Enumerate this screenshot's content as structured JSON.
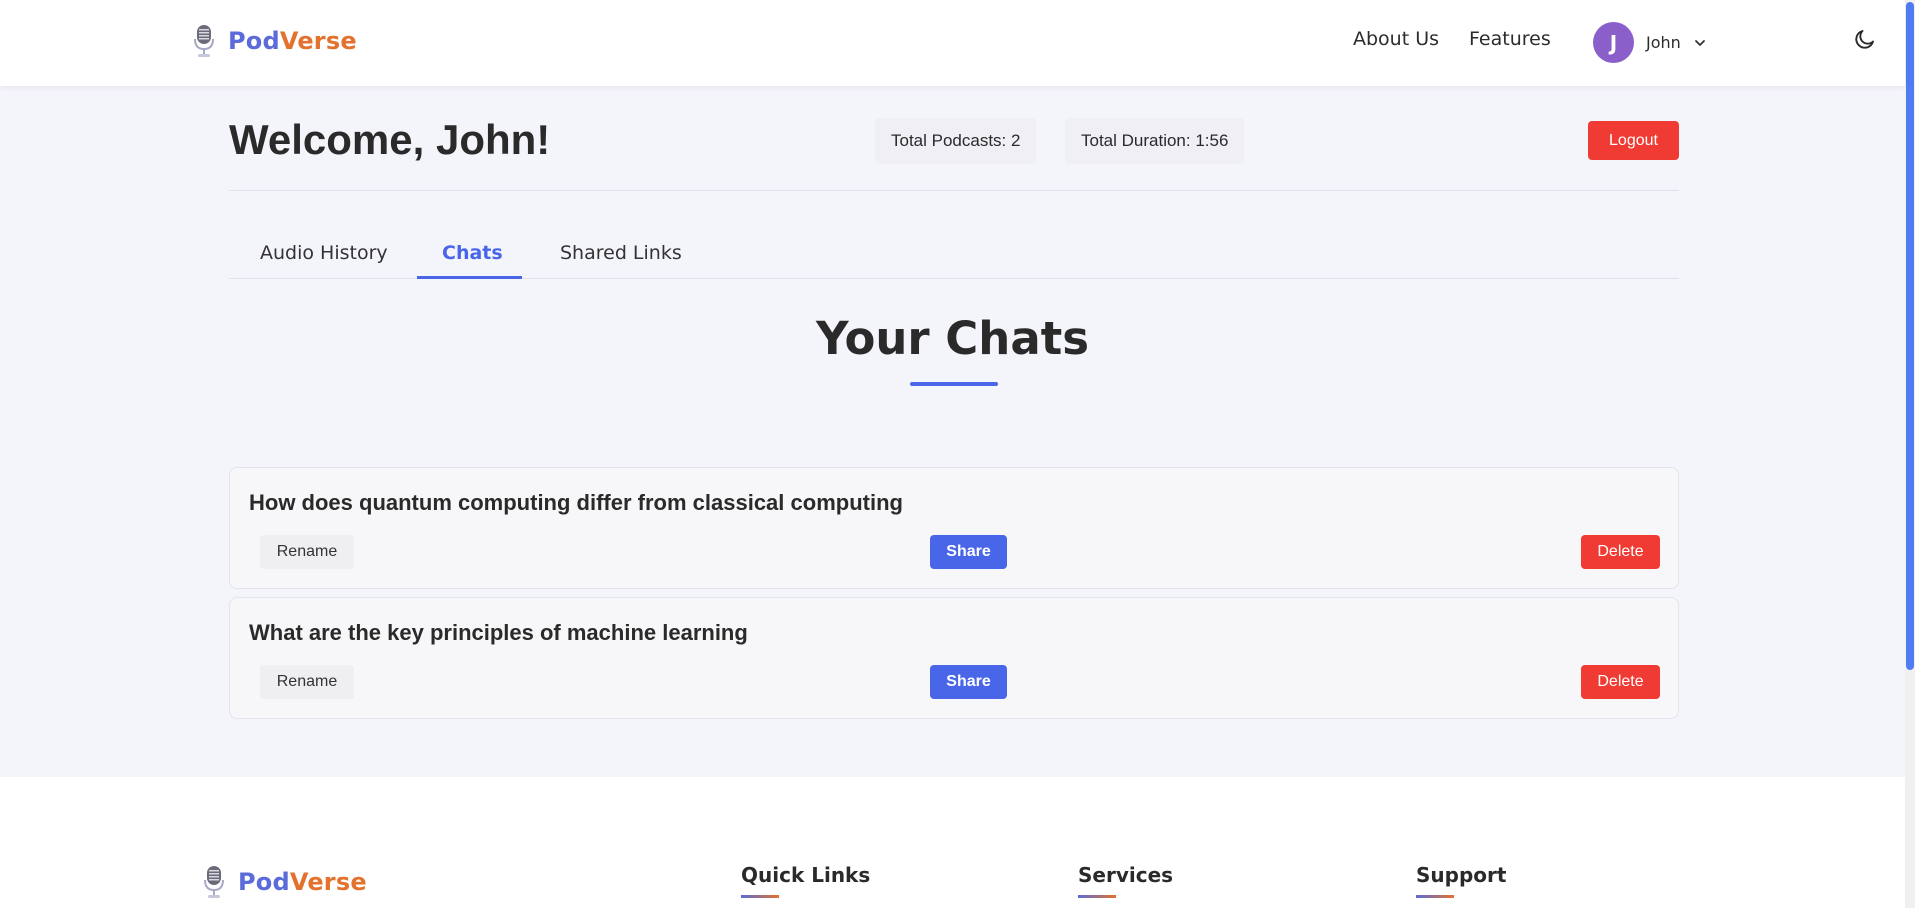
{
  "nav": {
    "brand_part1": "Pod",
    "brand_part2": "Verse",
    "links": [
      "About Us",
      "Features"
    ],
    "user_initial": "J",
    "user_name": "John"
  },
  "header": {
    "welcome": "Welcome, John!",
    "total_podcasts": "Total Podcasts: 2",
    "total_duration": "Total Duration: 1:56",
    "logout_label": "Logout"
  },
  "tabs": [
    {
      "label": "Audio History",
      "active": false
    },
    {
      "label": "Chats",
      "active": true
    },
    {
      "label": "Shared Links",
      "active": false
    }
  ],
  "section_title": "Your Chats",
  "chats": [
    {
      "title": "How does quantum computing differ from classical computing"
    },
    {
      "title": "What are the key principles of machine learning"
    }
  ],
  "chat_actions": {
    "rename_label": "Rename",
    "share_label": "Share",
    "delete_label": "Delete"
  },
  "footer": {
    "brand_part1": "Pod",
    "brand_part2": "Verse",
    "columns": [
      "Quick Links",
      "Services",
      "Support"
    ]
  },
  "colors": {
    "accent": "#4a66e8",
    "danger": "#ef3b33",
    "brand_blue": "#5b6bd9",
    "brand_orange": "#e3722f",
    "avatar": "#8b5fc9"
  }
}
